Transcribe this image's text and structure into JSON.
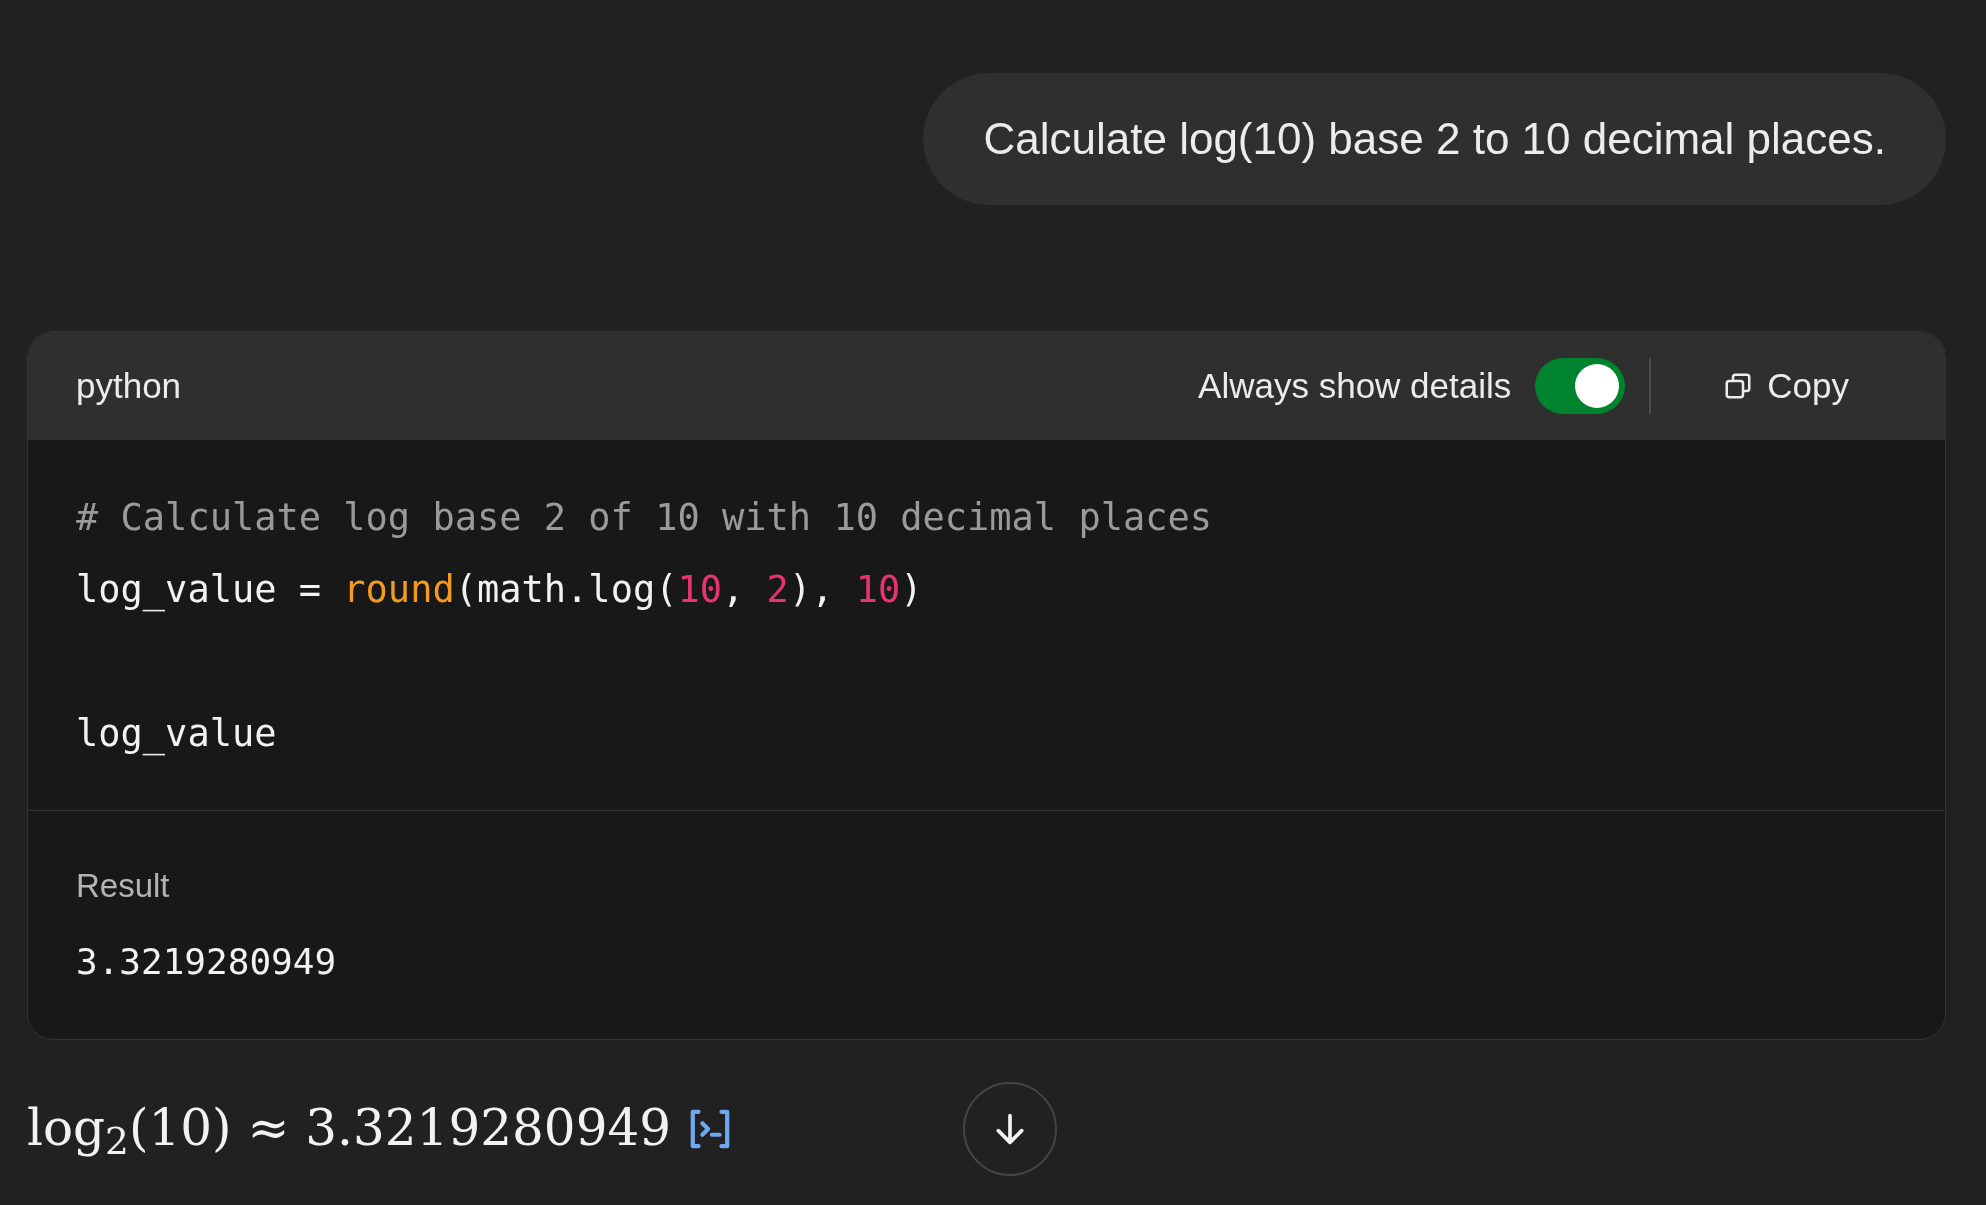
{
  "user_message": "Calculate log(10) base 2 to 10 decimal places.",
  "code_block": {
    "language": "python",
    "details_toggle": {
      "label": "Always show details",
      "on": true
    },
    "copy_label": "Copy",
    "lines": [
      {
        "kind": "code",
        "tokens": [
          {
            "kind": "comment",
            "text": "# Calculate log base 2 of 10 with 10 decimal places"
          }
        ]
      },
      {
        "kind": "code",
        "tokens": [
          {
            "kind": "plain",
            "text": "log_value = "
          },
          {
            "kind": "builtin",
            "text": "round"
          },
          {
            "kind": "plain",
            "text": "(math.log("
          },
          {
            "kind": "number",
            "text": "10"
          },
          {
            "kind": "plain",
            "text": ", "
          },
          {
            "kind": "number",
            "text": "2"
          },
          {
            "kind": "plain",
            "text": "), "
          },
          {
            "kind": "number",
            "text": "10"
          },
          {
            "kind": "plain",
            "text": ")"
          }
        ]
      },
      {
        "kind": "blank"
      },
      {
        "kind": "code",
        "tokens": [
          {
            "kind": "plain",
            "text": "log_value"
          }
        ]
      }
    ],
    "result": {
      "label": "Result",
      "value": "3.3219280949"
    }
  },
  "answer": "log$_{2}$(10) ≈ 3.3219280949"
}
